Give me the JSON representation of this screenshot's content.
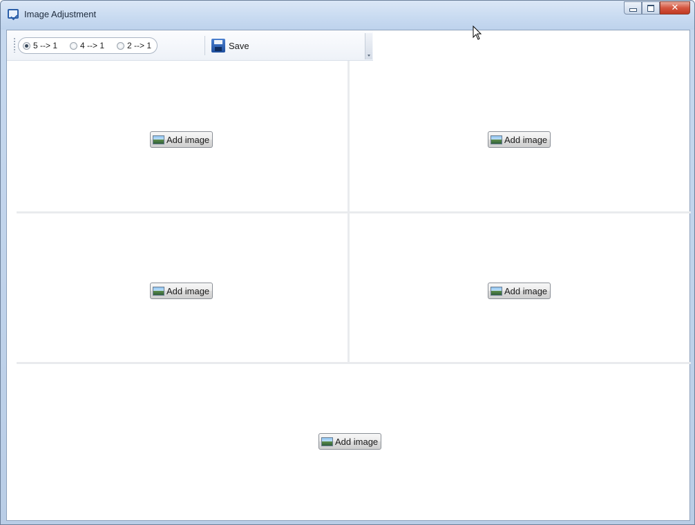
{
  "window": {
    "title": "Image Adjustment",
    "caption_buttons": {
      "minimize": "minimize-icon",
      "maximize": "maximize-icon",
      "close": "close-icon"
    }
  },
  "toolbar": {
    "radio_options": [
      {
        "label": "5 --> 1",
        "checked": true
      },
      {
        "label": "4 --> 1",
        "checked": false
      },
      {
        "label": "2 --> 1",
        "checked": false
      }
    ],
    "save_label": "Save",
    "save_icon": "floppy-disk-icon"
  },
  "grid": {
    "cells": [
      {
        "button_label": "Add image",
        "icon": "image-icon"
      },
      {
        "button_label": "Add image",
        "icon": "image-icon"
      },
      {
        "button_label": "Add image",
        "icon": "image-icon"
      },
      {
        "button_label": "Add image",
        "icon": "image-icon"
      },
      {
        "button_label": "Add image",
        "icon": "image-icon"
      }
    ]
  },
  "colors": {
    "titlebar": "#c9dbf1",
    "close_button": "#d4553f",
    "divider": "#e9ebee"
  }
}
